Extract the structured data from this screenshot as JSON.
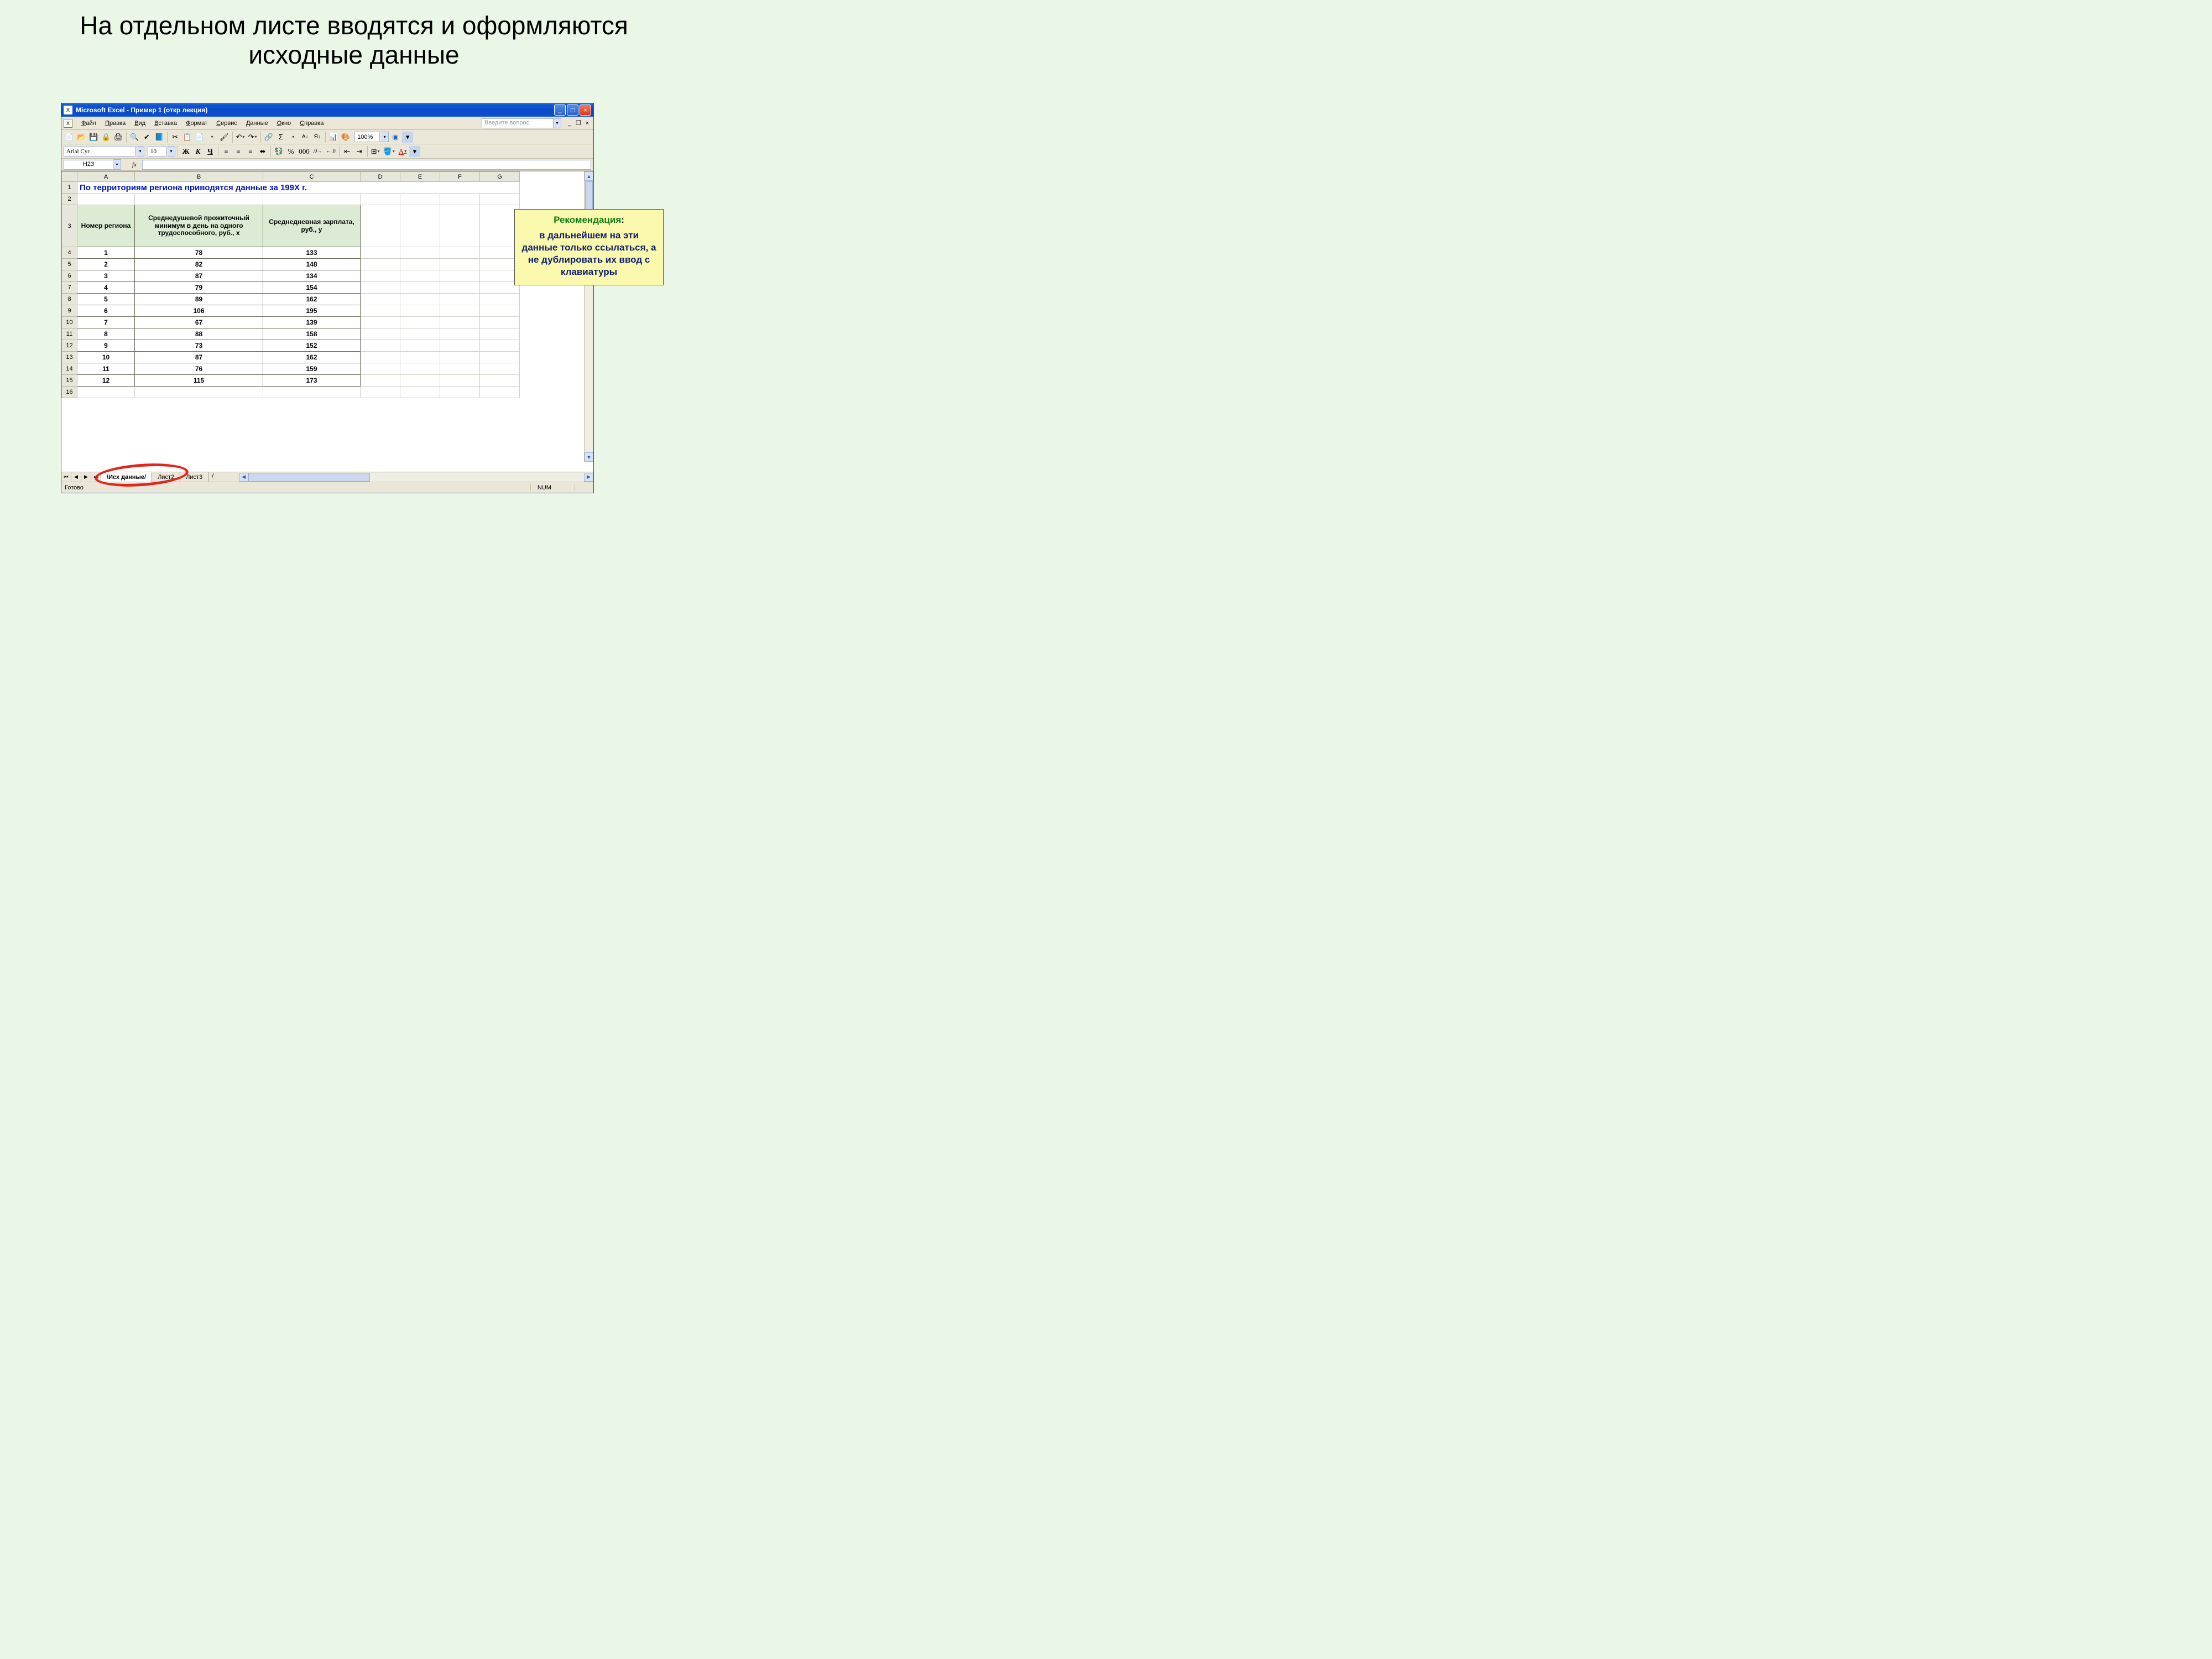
{
  "slide": {
    "title": "На отдельном листе вводятся и оформляются исходные данные"
  },
  "window": {
    "title": "Microsoft Excel - Пример 1 (откр лекция)"
  },
  "menu": {
    "file": "Файл",
    "edit": "Правка",
    "view": "Вид",
    "insert": "Вставка",
    "format": "Формат",
    "tools": "Сервис",
    "data": "Данные",
    "window": "Окно",
    "help": "Справка",
    "helpbox_placeholder": "Введите вопрос"
  },
  "format_toolbar": {
    "font_name": "Arial Cyr",
    "font_size": "10",
    "bold": "Ж",
    "italic": "К",
    "underline": "Ч",
    "percent": "%",
    "thousands": "000",
    "zoom": "100%"
  },
  "namebox": {
    "ref": "H23",
    "fx": "fx"
  },
  "columns": [
    "A",
    "B",
    "C",
    "D",
    "E",
    "F",
    "G"
  ],
  "row_numbers": [
    "1",
    "2",
    "3",
    "4",
    "5",
    "6",
    "7",
    "8",
    "9",
    "10",
    "11",
    "12",
    "13",
    "14",
    "15",
    "16"
  ],
  "sheet": {
    "title_row": "По территориям региона приводятся данные за 199Х г.",
    "headers": {
      "a": "Номер региона",
      "b": "Среднедушевой прожиточный минимум в день на одного трудоспособного, руб., х",
      "c": "Среднедневная зарплата, руб., у"
    },
    "rows": [
      {
        "n": "1",
        "x": "78",
        "y": "133"
      },
      {
        "n": "2",
        "x": "82",
        "y": "148"
      },
      {
        "n": "3",
        "x": "87",
        "y": "134"
      },
      {
        "n": "4",
        "x": "79",
        "y": "154"
      },
      {
        "n": "5",
        "x": "89",
        "y": "162"
      },
      {
        "n": "6",
        "x": "106",
        "y": "195"
      },
      {
        "n": "7",
        "x": "67",
        "y": "139"
      },
      {
        "n": "8",
        "x": "88",
        "y": "158"
      },
      {
        "n": "9",
        "x": "73",
        "y": "152"
      },
      {
        "n": "10",
        "x": "87",
        "y": "162"
      },
      {
        "n": "11",
        "x": "76",
        "y": "159"
      },
      {
        "n": "12",
        "x": "115",
        "y": "173"
      }
    ]
  },
  "tabs": {
    "t1": "Исх данные",
    "t2": "Лист2",
    "t3": "Лист3"
  },
  "status": {
    "ready": "Готово",
    "num": "NUM"
  },
  "callout": {
    "heading": "Рекомендация",
    "colon": ":",
    "body": "в дальнейшем на эти данные только ссылаться, а не дублировать их ввод с клавиатуры"
  }
}
